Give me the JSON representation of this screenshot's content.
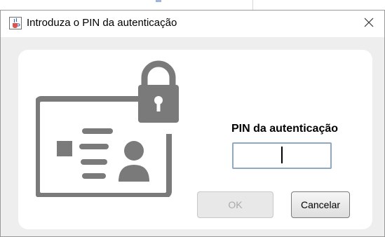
{
  "window": {
    "title": "Introduza o PIN da autenticação",
    "icons": {
      "app": "java-cup-icon",
      "close": "close-icon"
    }
  },
  "content": {
    "illustration": "id-card-with-padlock-icon",
    "pin_label": "PIN da autenticação",
    "pin_input": {
      "value": "",
      "placeholder": ""
    }
  },
  "buttons": {
    "ok_label": "OK",
    "ok_enabled": false,
    "cancel_label": "Cancelar"
  },
  "colors": {
    "illustration_gray": "#7a7a7a",
    "dialog_background": "#eeeeee",
    "input_border": "#8fa8c4"
  }
}
